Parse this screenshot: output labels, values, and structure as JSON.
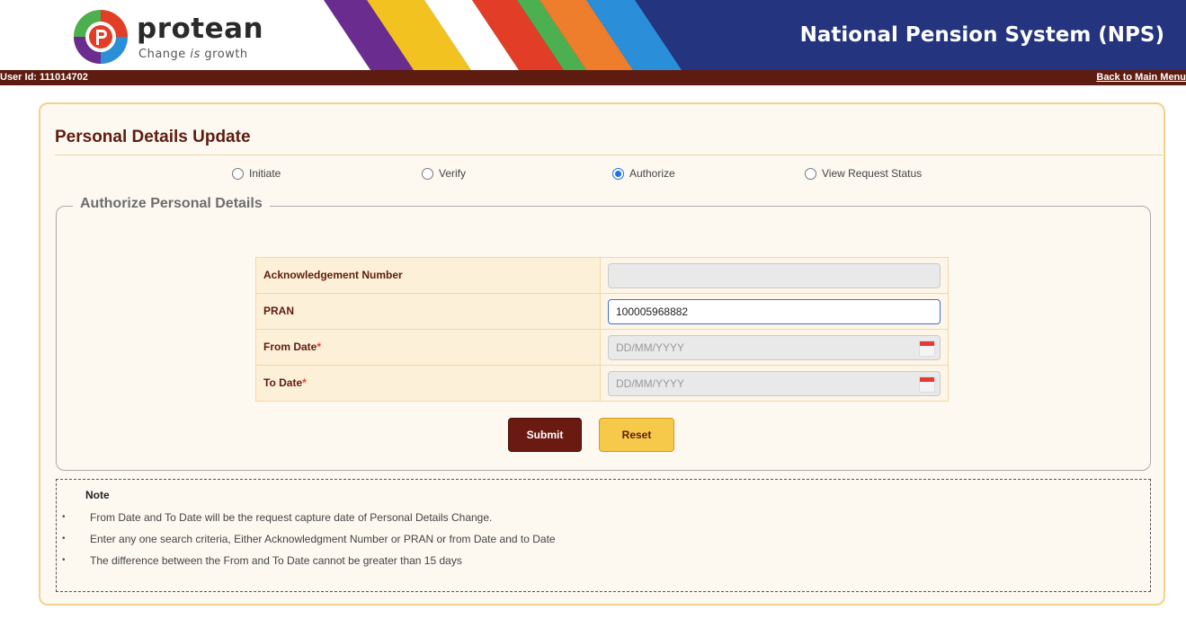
{
  "header": {
    "brand": "protean",
    "tagline_pre": "Change ",
    "tagline_em": "is",
    "tagline_post": " growth",
    "app_title": "National Pension System (NPS)"
  },
  "userbar": {
    "user_id": "User Id: 111014702",
    "back_link": "Back to Main Menu"
  },
  "card": {
    "title": "Personal Details Update",
    "radios": [
      {
        "label": "Initiate",
        "selected": false
      },
      {
        "label": "Verify",
        "selected": false
      },
      {
        "label": "Authorize",
        "selected": true
      },
      {
        "label": "View Request Status",
        "selected": false
      }
    ],
    "fieldset_legend": "Authorize Personal Details",
    "fields": {
      "ack": {
        "label": "Acknowledgement Number",
        "value": ""
      },
      "pran": {
        "label": "PRAN",
        "value": "100005968882"
      },
      "from": {
        "label": "From Date",
        "required_mark": "*",
        "placeholder": "DD/MM/YYYY"
      },
      "to": {
        "label": "To Date",
        "required_mark": "*",
        "placeholder": "DD/MM/YYYY"
      }
    },
    "buttons": {
      "submit": "Submit",
      "reset": "Reset"
    },
    "note": {
      "title": "Note",
      "items": [
        "From Date and To Date will be the request capture date of Personal Details Change.",
        "Enter any one search criteria, Either Acknowledgment Number or PRAN or from Date and to Date",
        "The difference between the From and To Date cannot be greater than 15 days"
      ]
    }
  },
  "colors": {
    "header_blue": "#24347e",
    "maroon": "#5e1c10",
    "accent_yellow": "#f6c94a",
    "radio_blue": "#1a73e8"
  }
}
